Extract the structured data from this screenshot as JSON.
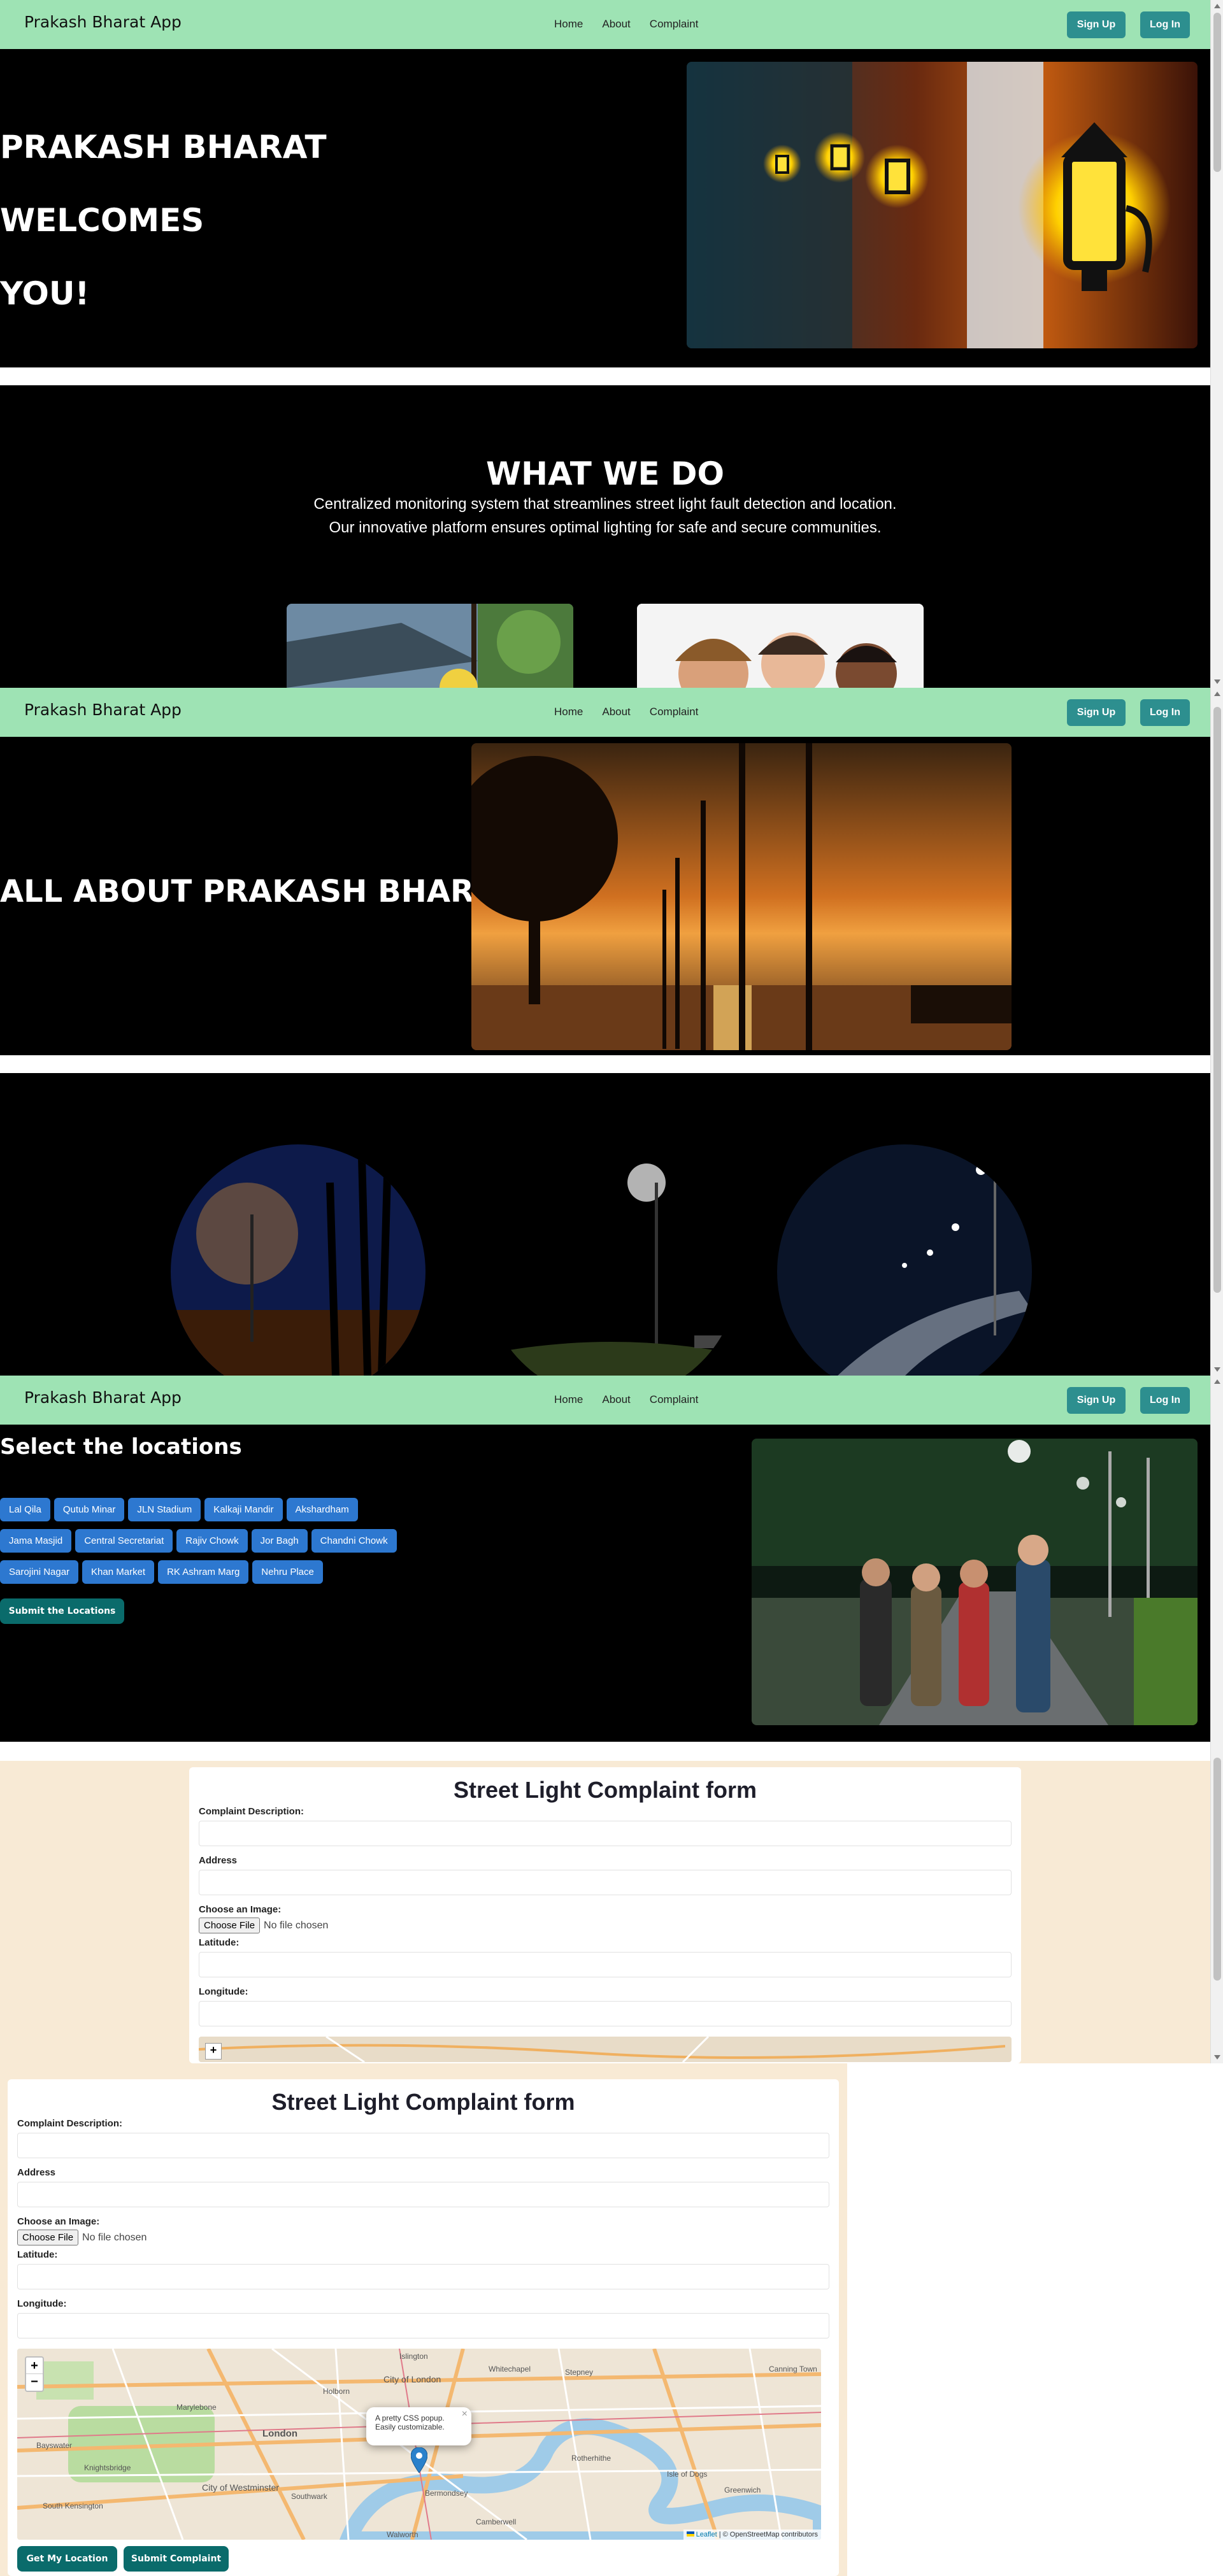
{
  "nav": {
    "brand": "Prakash Bharat App",
    "links": [
      "Home",
      "About",
      "Complaint"
    ],
    "signup": "Sign Up",
    "login": "Log In"
  },
  "home": {
    "hero_lines": [
      "PRAKASH BHARAT",
      "WELCOMES",
      "YOU!"
    ],
    "what_title": "WHAT WE DO",
    "what_line1": "Centralized monitoring system that streamlines street light fault detection and location.",
    "what_line2": "Our innovative platform ensures optimal lighting for safe and secure communities."
  },
  "about": {
    "title": "ALL ABOUT PRAKASH BHARAT"
  },
  "locations": {
    "title": "Select the locations",
    "chips": [
      "Lal Qila",
      "Qutub Minar",
      "JLN Stadium",
      "Kalkaji Mandir",
      "Akshardham",
      "Jama Masjid",
      "Central Secretariat",
      "Rajiv Chowk",
      "Jor Bagh",
      "Chandni Chowk",
      "Sarojini Nagar",
      "Khan Market",
      "RK Ashram Marg",
      "Nehru Place"
    ],
    "submit": "Submit the Locations"
  },
  "form": {
    "title": "Street Light Complaint form",
    "desc_label": "Complaint Description:",
    "address_label": "Address",
    "image_label": "Choose an Image:",
    "file_button": "Choose File",
    "no_file": "No file chosen",
    "lat_label": "Latitude:",
    "lon_label": "Longitude:",
    "get_location": "Get My Location",
    "submit": "Submit Complaint"
  },
  "map": {
    "zoom_in": "+",
    "zoom_out": "−",
    "popup_line1": "A pretty CSS popup.",
    "popup_line2": "Easily customizable.",
    "popup_close": "×",
    "attribution_leaflet": "Leaflet",
    "attribution_rest": "| © OpenStreetMap contributors",
    "labels": [
      "City of London",
      "Whitechapel",
      "Stepney",
      "Bayswater",
      "Marylebone",
      "Islington",
      "Canning Town",
      "Knightsbridge",
      "London",
      "Southwark",
      "City of Westminster",
      "Bermondsey",
      "Rotherhithe",
      "Greenwich",
      "Walworth",
      "Isle of Dogs",
      "South Kensington",
      "Holborn",
      "Camberwell"
    ]
  },
  "colors": {
    "nav_bg": "#9ee3b4",
    "teal": "#2d8f8f",
    "chip": "#2d78d0",
    "cream": "#f8ead5"
  }
}
